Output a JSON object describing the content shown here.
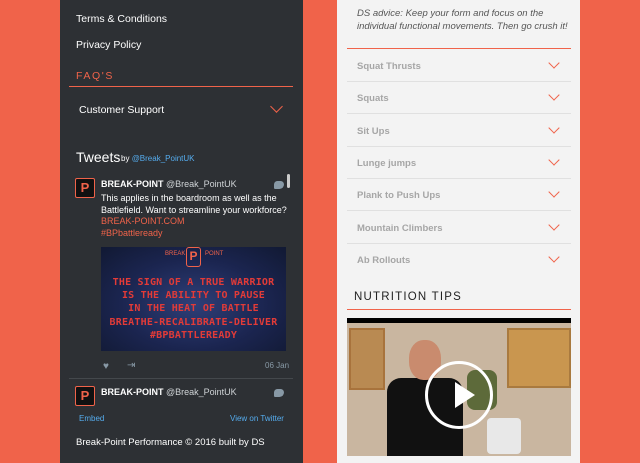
{
  "footer_links": {
    "terms": "Terms & Conditions",
    "privacy": "Privacy Policy"
  },
  "faq": {
    "heading": "FAQ'S",
    "items": [
      "Customer Support"
    ]
  },
  "tweets": {
    "title": "Tweets",
    "by": "by",
    "handle": "@Break_PointUK",
    "items": [
      {
        "name": "BREAK-POINT",
        "handle": "@Break_PointUK",
        "text": "This applies in the boardroom as well as the Battlefield. Want to streamline your workforce?",
        "link": "BREAK-POINT.COM",
        "hashtag": "#BPbattleready",
        "image": {
          "logo_left": "BREAK",
          "logo_mark": "P",
          "logo_right": "POINT",
          "lines": [
            "THE SIGN OF A TRUE WARRIOR",
            "IS THE ABILITY TO PAUSE",
            "IN THE HEAT OF BATTLE",
            "BREATHE-RECALIBRATE-DELIVER",
            "#BPBATTLEREADY"
          ]
        },
        "date": "06 Jan"
      },
      {
        "name": "BREAK-POINT",
        "handle": "@Break_PointUK"
      }
    ],
    "embed": "Embed",
    "view_on_twitter": "View on Twitter"
  },
  "copyright": "Break-Point Performance © 2016 built by DS",
  "advice": "DS advice: Keep your form and focus on the individual functional movements. Then go crush it!",
  "exercises": [
    "Squat Thrusts",
    "Squats",
    "Sit Ups",
    "Lunge jumps",
    "Plank to Push Ups",
    "Mountain Climbers",
    "Ab Rollouts"
  ],
  "nutrition": {
    "heading": "NUTRITION TIPS"
  },
  "colors": {
    "accent": "#f0634a",
    "dark_panel": "#2d3034",
    "light_panel": "#f3f3f3",
    "twitter_blue": "#55acee"
  }
}
